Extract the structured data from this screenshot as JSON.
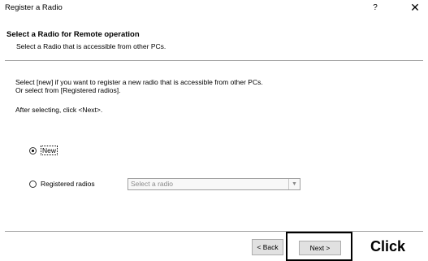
{
  "window": {
    "title": "Register a Radio",
    "help_label": "?",
    "close_label": "✕"
  },
  "header": {
    "heading": "Select a Radio for Remote operation",
    "subheading": "Select a Radio that is accessible from other PCs."
  },
  "body": {
    "desc_line1": "Select [new] if you want to register a new radio that is accessible from other PCs.",
    "desc_line2": "Or select from [Registered radios].",
    "after_text": "After selecting, click <Next>."
  },
  "options": {
    "new_label": "New",
    "registered_label": "Registered radios",
    "selected": "new",
    "select_placeholder": "Select a radio"
  },
  "footer": {
    "back_label": "< Back",
    "next_label": "Next >"
  },
  "annotation": {
    "click_label": "Click"
  }
}
